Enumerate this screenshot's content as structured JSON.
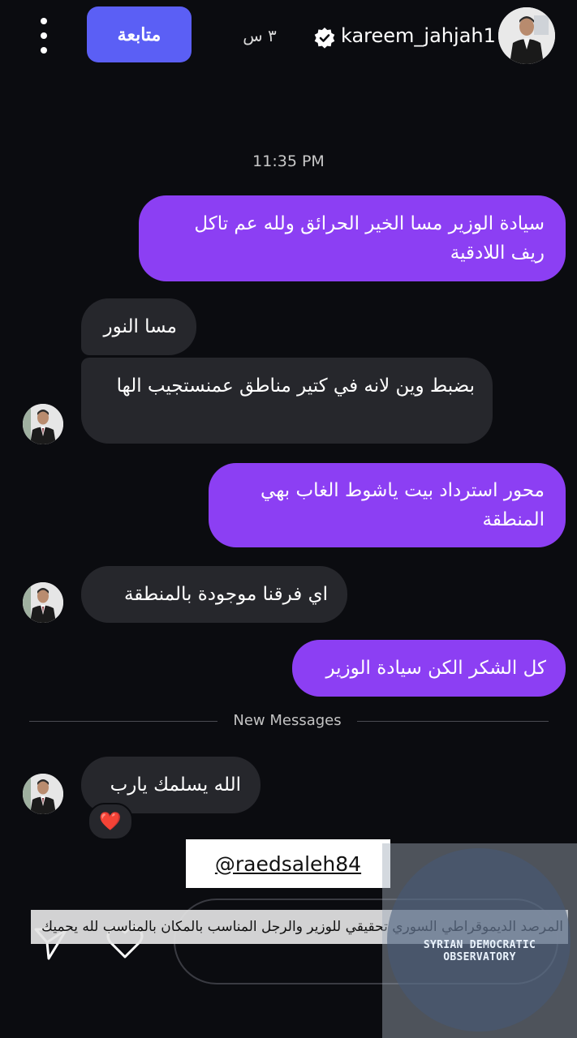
{
  "header": {
    "username": "kareem_jahjah1",
    "time_ago": "٣ س",
    "follow_label": "متابعة",
    "icons": [
      "menu-dots-icon",
      "verified-badge-icon"
    ]
  },
  "timestamp": "11:35 PM",
  "messages": [
    {
      "direction": "outgoing",
      "text": "سيادة الوزير مسا الخير الحرائق ولله عم تاكل ريف اللادقية"
    },
    {
      "direction": "incoming",
      "text": "مسا النور"
    },
    {
      "direction": "incoming",
      "text": "بضبط وين لانه في كتير مناطق عمنستجيب الها"
    },
    {
      "direction": "outgoing",
      "text": "محور استرداد بيت ياشوط الغاب بهي المنطقة"
    },
    {
      "direction": "incoming",
      "text": "اي فرقنا موجودة بالمنطقة"
    },
    {
      "direction": "outgoing",
      "text": "كل الشكر الكن سيادة الوزير"
    },
    {
      "direction": "incoming",
      "text": "الله يسلمك يارب",
      "reaction": "❤️"
    }
  ],
  "new_messages_label": "New Messages",
  "overlay": {
    "handle": "@raedsaleh84",
    "caption": "المرصد الديموقراطي السوري تحقيقي للوزير والرجل المناسب بالمكان بالمناسب لله يحميك",
    "watermark": "SYRIAN DEMOCRATIC OBSERVATORY"
  },
  "colors": {
    "background": "#0b0c10",
    "outgoing_bubble": "#8c3ff3",
    "incoming_bubble": "#26272c",
    "follow_button": "#5b5ff5"
  }
}
